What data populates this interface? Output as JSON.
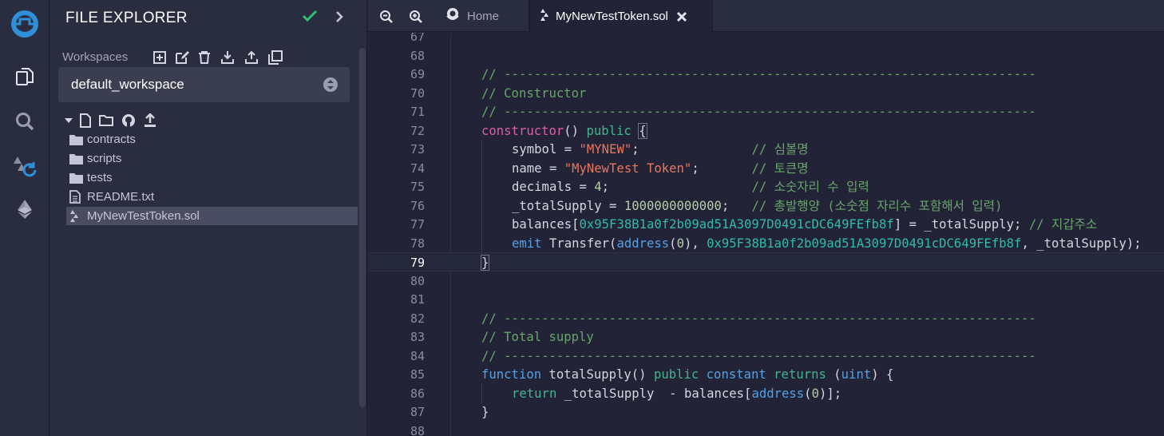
{
  "sidebar": {
    "title": "FILE EXPLORER",
    "workspaces_label": "Workspaces",
    "workspace_selected": "default_workspace",
    "files": [
      {
        "name": "contracts",
        "kind": "folder"
      },
      {
        "name": "scripts",
        "kind": "folder"
      },
      {
        "name": "tests",
        "kind": "folder"
      },
      {
        "name": "README.txt",
        "kind": "file"
      },
      {
        "name": "MyNewTestToken.sol",
        "kind": "solidity",
        "active": true
      }
    ]
  },
  "tabs": {
    "home": "Home",
    "file": "MyNewTestToken.sol"
  },
  "editor": {
    "current_line": 79,
    "lines": [
      {
        "n": 67,
        "tokens": []
      },
      {
        "n": 68,
        "tokens": []
      },
      {
        "n": 69,
        "indent": 0,
        "tokens": [
          [
            "c-comment",
            "// -----------------------------------------------------------------------"
          ]
        ]
      },
      {
        "n": 70,
        "indent": 0,
        "tokens": [
          [
            "c-comment",
            "// Constructor"
          ]
        ]
      },
      {
        "n": 71,
        "indent": 0,
        "tokens": [
          [
            "c-comment",
            "// -----------------------------------------------------------------------"
          ]
        ]
      },
      {
        "n": 72,
        "indent": 0,
        "tokens": [
          [
            "c-key",
            "constructor"
          ],
          [
            "c-plain",
            "() "
          ],
          [
            "c-mod",
            "public"
          ],
          [
            "c-plain",
            " "
          ],
          [
            "c-brack",
            "{"
          ]
        ]
      },
      {
        "n": 73,
        "indent": 1,
        "tokens": [
          [
            "c-plain",
            "symbol = "
          ],
          [
            "c-str",
            "\"MYNEW\""
          ],
          [
            "c-plain",
            ";               "
          ],
          [
            "c-comment",
            "// 심볼명"
          ]
        ]
      },
      {
        "n": 74,
        "indent": 1,
        "tokens": [
          [
            "c-plain",
            "name = "
          ],
          [
            "c-str",
            "\"MyNewTest Token\""
          ],
          [
            "c-plain",
            ";       "
          ],
          [
            "c-comment",
            "// 토큰명"
          ]
        ]
      },
      {
        "n": 75,
        "indent": 1,
        "tokens": [
          [
            "c-plain",
            "decimals = "
          ],
          [
            "c-num",
            "4"
          ],
          [
            "c-plain",
            ";                   "
          ],
          [
            "c-comment",
            "// 소숫자리 수 입력"
          ]
        ]
      },
      {
        "n": 76,
        "indent": 1,
        "tokens": [
          [
            "c-plain",
            "_totalSupply = "
          ],
          [
            "c-num",
            "1000000000000"
          ],
          [
            "c-plain",
            ";   "
          ],
          [
            "c-comment",
            "// 총발행양 (소숫점 자리수 포함해서 입력)"
          ]
        ]
      },
      {
        "n": 77,
        "indent": 1,
        "tokens": [
          [
            "c-plain",
            "balances["
          ],
          [
            "c-addr",
            "0x95F38B1a0f2b09ad51A3097D0491cDC649FEfb8f"
          ],
          [
            "c-plain",
            "] = _totalSupply; "
          ],
          [
            "c-comment",
            "// 지갑주소"
          ]
        ]
      },
      {
        "n": 78,
        "indent": 1,
        "tokens": [
          [
            "c-type",
            "emit"
          ],
          [
            "c-plain",
            " Transfer("
          ],
          [
            "c-type",
            "address"
          ],
          [
            "c-plain",
            "("
          ],
          [
            "c-num",
            "0"
          ],
          [
            "c-plain",
            "), "
          ],
          [
            "c-addr",
            "0x95F38B1a0f2b09ad51A3097D0491cDC649FEfb8f"
          ],
          [
            "c-plain",
            ", _totalSupply);"
          ]
        ]
      },
      {
        "n": 79,
        "indent": 0,
        "tokens": [
          [
            "c-brack",
            "}"
          ]
        ]
      },
      {
        "n": 80,
        "tokens": []
      },
      {
        "n": 81,
        "tokens": []
      },
      {
        "n": 82,
        "indent": 0,
        "tokens": [
          [
            "c-comment",
            "// -----------------------------------------------------------------------"
          ]
        ]
      },
      {
        "n": 83,
        "indent": 0,
        "tokens": [
          [
            "c-comment",
            "// Total supply"
          ]
        ]
      },
      {
        "n": 84,
        "indent": 0,
        "tokens": [
          [
            "c-comment",
            "// -----------------------------------------------------------------------"
          ]
        ]
      },
      {
        "n": 85,
        "indent": 0,
        "tokens": [
          [
            "c-type",
            "function"
          ],
          [
            "c-plain",
            " totalSupply() "
          ],
          [
            "c-mod",
            "public"
          ],
          [
            "c-plain",
            " "
          ],
          [
            "c-type",
            "constant"
          ],
          [
            "c-plain",
            " "
          ],
          [
            "c-mod",
            "returns"
          ],
          [
            "c-plain",
            " ("
          ],
          [
            "c-type",
            "uint"
          ],
          [
            "c-plain",
            ") {"
          ]
        ]
      },
      {
        "n": 86,
        "indent": 1,
        "tokens": [
          [
            "c-mod",
            "return"
          ],
          [
            "c-plain",
            " _totalSupply  - balances["
          ],
          [
            "c-type",
            "address"
          ],
          [
            "c-plain",
            "("
          ],
          [
            "c-num",
            "0"
          ],
          [
            "c-plain",
            ")];"
          ]
        ]
      },
      {
        "n": 87,
        "indent": 0,
        "tokens": [
          [
            "c-plain",
            "}"
          ]
        ]
      },
      {
        "n": 88,
        "tokens": []
      }
    ]
  }
}
